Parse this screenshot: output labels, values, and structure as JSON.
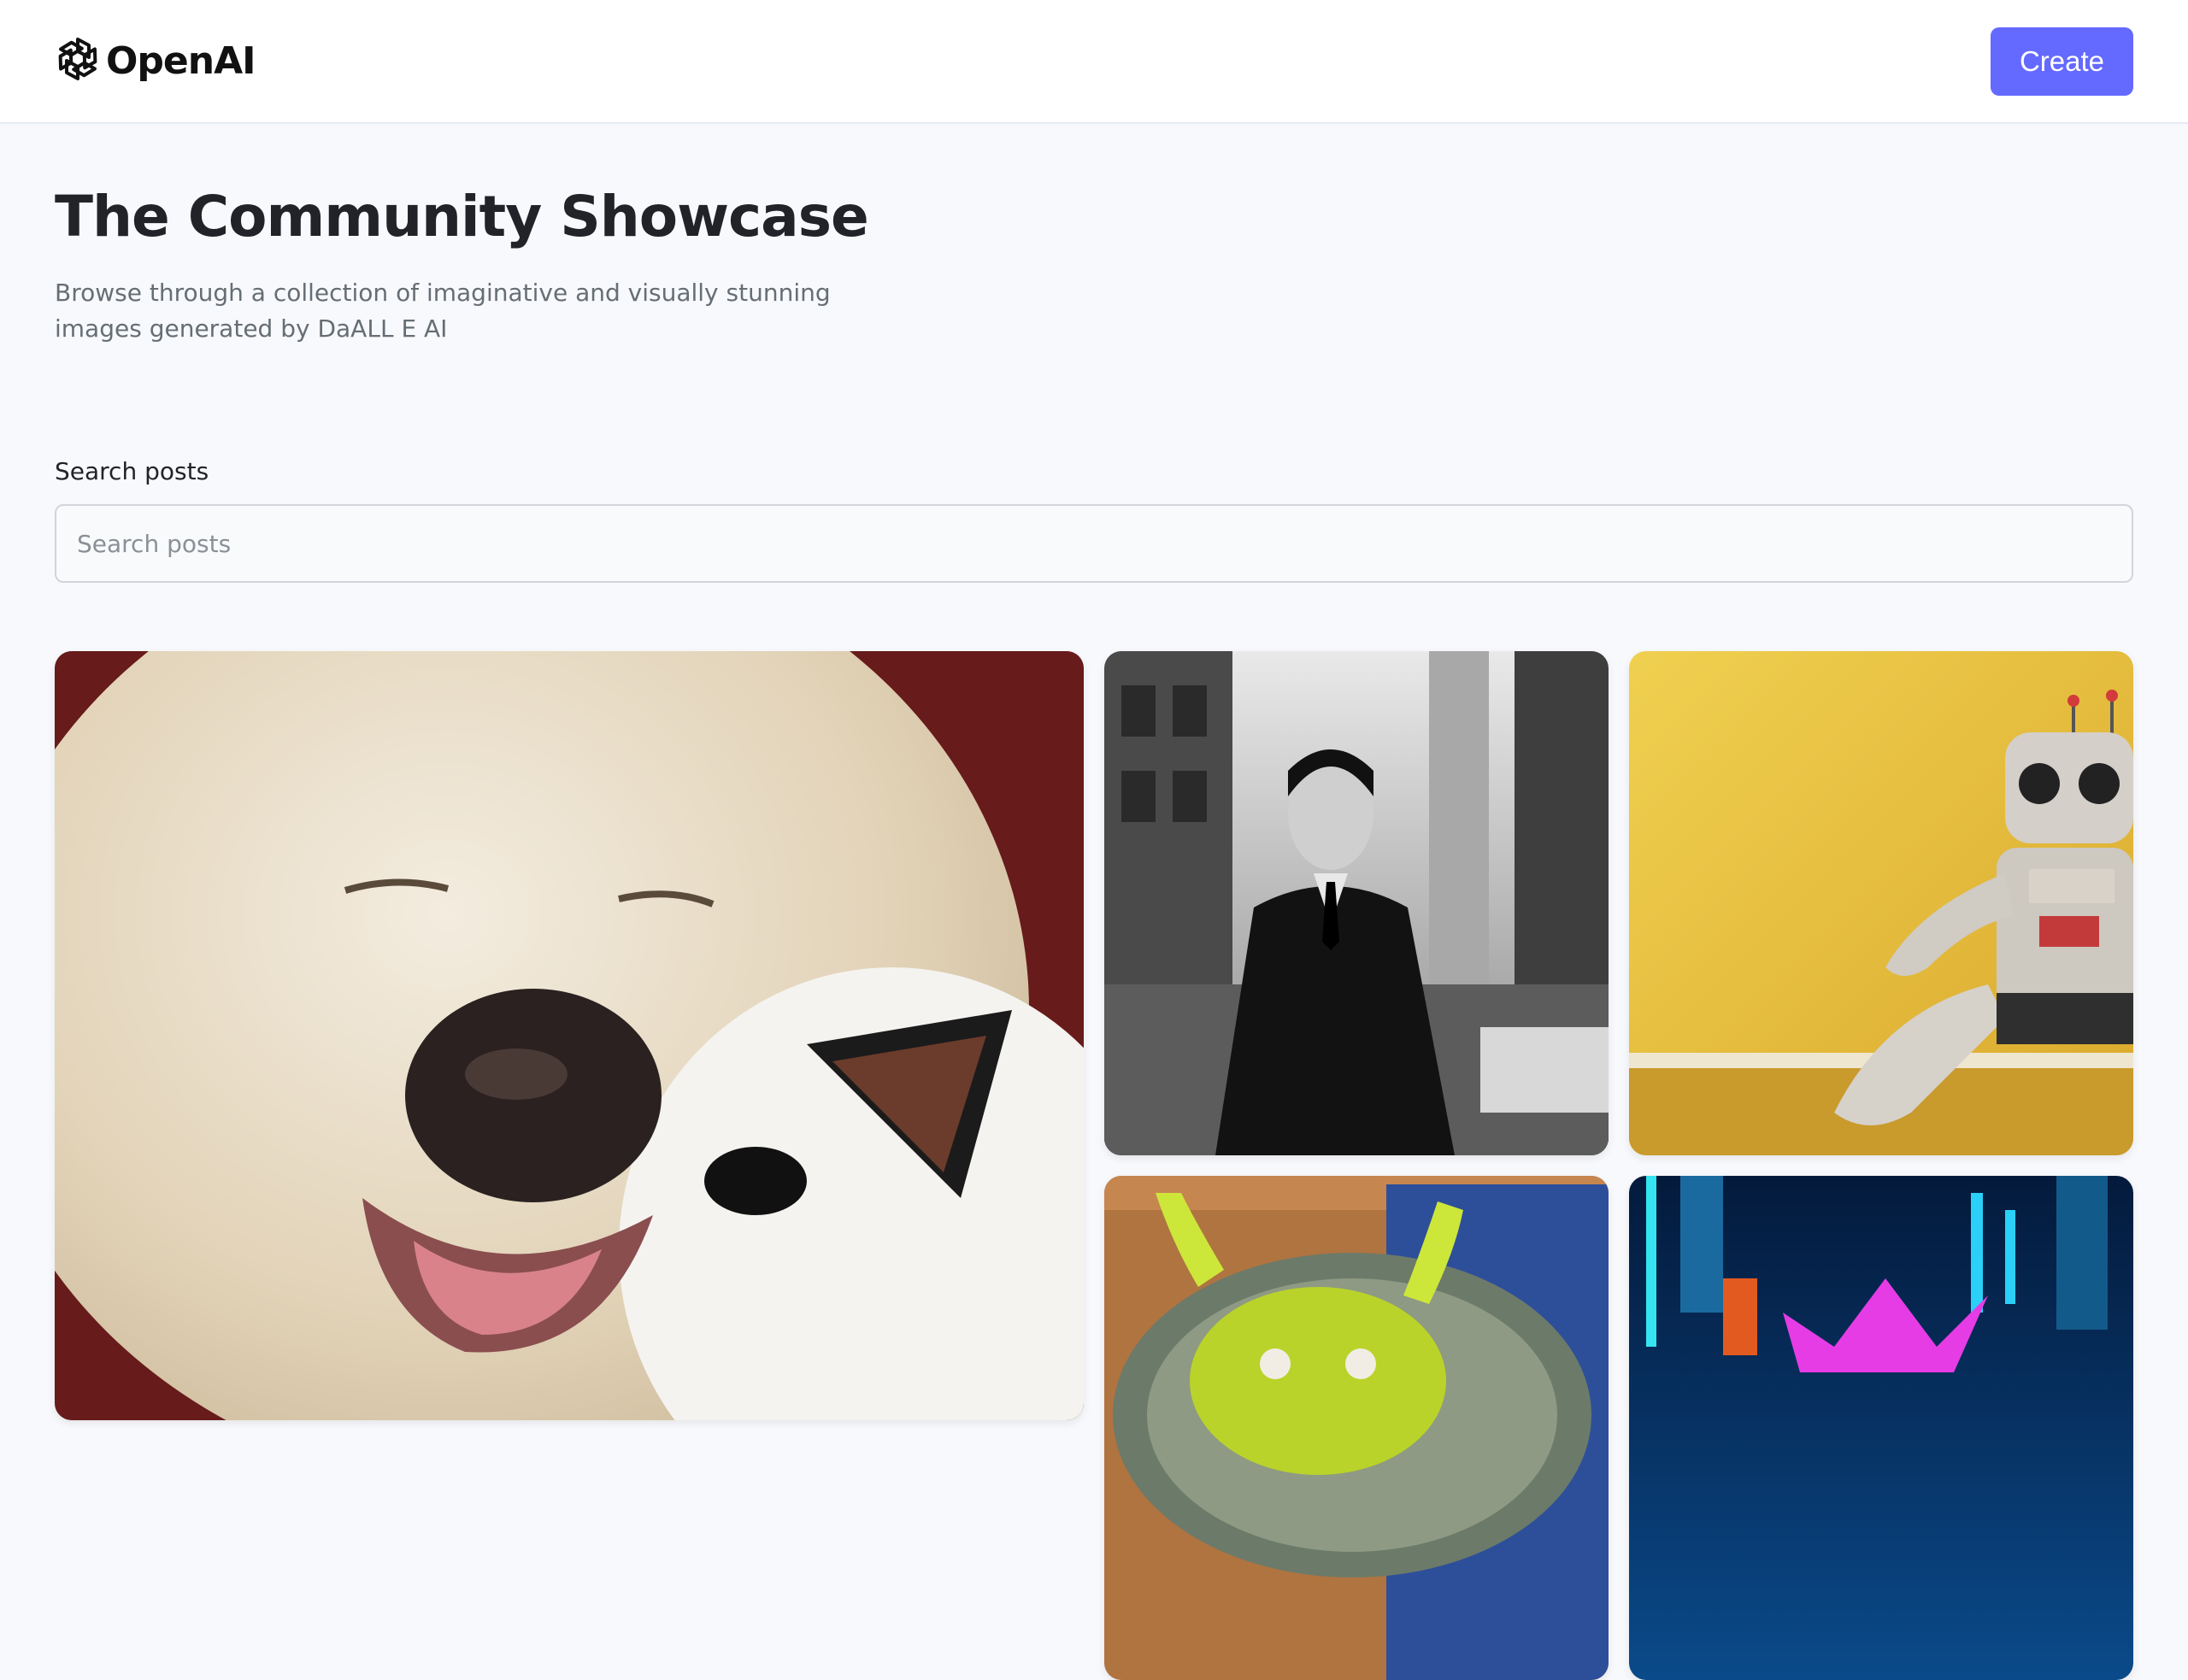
{
  "header": {
    "brand": "OpenAI",
    "create_label": "Create"
  },
  "hero": {
    "title": "The Community Showcase",
    "subtitle": "Browse through a collection of imaginative and visually stunning images generated by DaALL E AI"
  },
  "search": {
    "label": "Search posts",
    "placeholder": "Search posts",
    "value": ""
  },
  "colors": {
    "accent": "#6469ff",
    "title": "#222328",
    "subtitle": "#666e75",
    "background": "#f8f9fc"
  }
}
